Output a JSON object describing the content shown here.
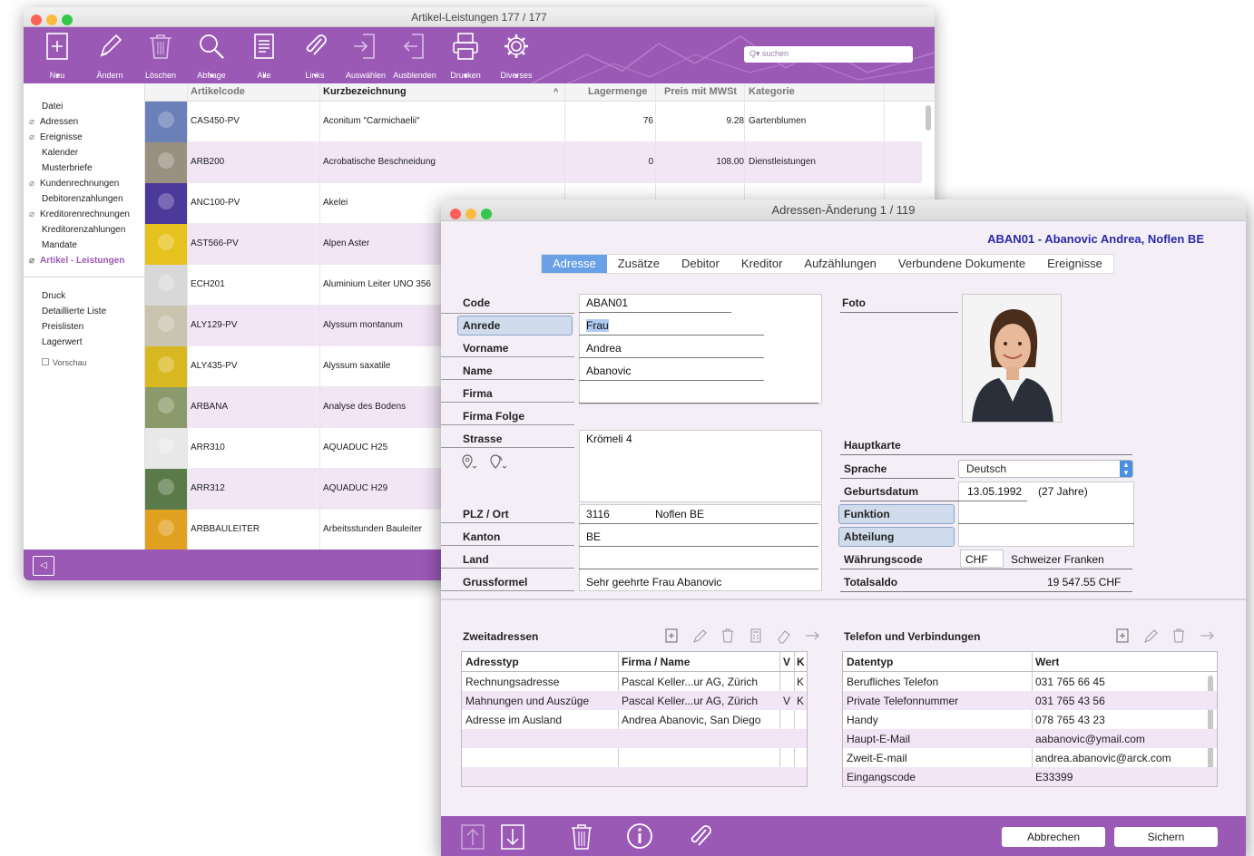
{
  "list_window": {
    "title": "Artikel-Leistungen  177 / 177",
    "toolbar": {
      "buttons": [
        {
          "label": "Neu",
          "icon": "new-document-icon",
          "dropdown": true
        },
        {
          "label": "Ändern",
          "icon": "pencil-icon",
          "dropdown": false
        },
        {
          "label": "Löschen",
          "icon": "trash-icon",
          "dropdown": false
        },
        {
          "label": "Abfrage",
          "icon": "magnifier-icon",
          "dropdown": true
        },
        {
          "label": "Alle",
          "icon": "document-list-icon",
          "dropdown": true
        },
        {
          "label": "Links",
          "icon": "paperclip-icon",
          "dropdown": true
        },
        {
          "label": "Auswählen",
          "icon": "select-arrow-icon",
          "dropdown": false
        },
        {
          "label": "Ausblenden",
          "icon": "hide-arrow-icon",
          "dropdown": false
        },
        {
          "label": "Drucken",
          "icon": "printer-icon",
          "dropdown": true
        },
        {
          "label": "Diverses",
          "icon": "gear-icon",
          "dropdown": true
        }
      ],
      "search_placeholder": "suchen"
    },
    "sidebar": {
      "items": [
        {
          "label": "Datei",
          "clip": false,
          "active": false
        },
        {
          "label": "Adressen",
          "clip": true,
          "active": false
        },
        {
          "label": "Ereignisse",
          "clip": true,
          "active": false
        },
        {
          "label": "Kalender",
          "clip": false,
          "active": false
        },
        {
          "label": "Musterbriefe",
          "clip": false,
          "active": false
        },
        {
          "label": "Kundenrechnungen",
          "clip": true,
          "active": false
        },
        {
          "label": "Debitorenzahlungen",
          "clip": false,
          "active": false
        },
        {
          "label": "Kreditorenrechnungen",
          "clip": true,
          "active": false
        },
        {
          "label": "Kreditorenzahlungen",
          "clip": false,
          "active": false
        },
        {
          "label": "Mandate",
          "clip": false,
          "active": false
        },
        {
          "label": "Artikel - Leistungen",
          "clip": true,
          "active": true
        }
      ],
      "reports": [
        "Druck",
        "Detaillierte Liste",
        "Preislisten",
        "Lagerwert"
      ],
      "preview_label": "Vorschau"
    },
    "columns": [
      "Artikelcode",
      "Kurzbezeichnung",
      "Lagermenge",
      "Preis mit MWSt",
      "Kategorie"
    ],
    "sort_indicator": "^",
    "rows": [
      {
        "code": "CAS450-PV",
        "name": "Aconitum \"Carmichaelii\"",
        "qty": "76",
        "price": "9.28",
        "cat": "Gartenblumen",
        "thumb": "#6b7fb8"
      },
      {
        "code": "ARB200",
        "name": "Acrobatische Beschneidung",
        "qty": "0",
        "price": "108.00",
        "cat": "Dienstleistungen",
        "thumb": "#9a9080"
      },
      {
        "code": "ANC100-PV",
        "name": "Akelei",
        "qty": "",
        "price": "",
        "cat": "",
        "thumb": "#4b3a9a"
      },
      {
        "code": "AST566-PV",
        "name": "Alpen Aster",
        "qty": "",
        "price": "",
        "cat": "",
        "thumb": "#e6c21e"
      },
      {
        "code": "ECH201",
        "name": "Aluminium Leiter UNO 356",
        "qty": "",
        "price": "",
        "cat": "",
        "thumb": "#d8d8d8"
      },
      {
        "code": "ALY129-PV",
        "name": "Alyssum montanum",
        "qty": "",
        "price": "",
        "cat": "",
        "thumb": "#c8c4b0"
      },
      {
        "code": "ALY435-PV",
        "name": "Alyssum saxatile",
        "qty": "",
        "price": "",
        "cat": "",
        "thumb": "#d8b820"
      },
      {
        "code": "ARBANA",
        "name": "Analyse des Bodens",
        "qty": "",
        "price": "",
        "cat": "",
        "thumb": "#8a9a6a"
      },
      {
        "code": "ARR310",
        "name": "AQUADUC H25",
        "qty": "",
        "price": "",
        "cat": "",
        "thumb": "#e8e8e8"
      },
      {
        "code": "ARR312",
        "name": "AQUADUC H29",
        "qty": "",
        "price": "",
        "cat": "",
        "thumb": "#5a7a4a"
      },
      {
        "code": "ARBBAULEITER",
        "name": "Arbeitsstunden Bauleiter",
        "qty": "",
        "price": "",
        "cat": "",
        "thumb": "#e0a020"
      }
    ]
  },
  "address_window": {
    "title": "Adressen-Änderung   1 / 119",
    "header": "ABAN01 - Abanovic Andrea, Noflen BE",
    "tabs": [
      "Adresse",
      "Zusätze",
      "Debitor",
      "Kreditor",
      "Aufzählungen",
      "Verbundene Dokumente",
      "Ereignisse"
    ],
    "fields": {
      "code_label": "Code",
      "code": "ABAN01",
      "anrede_label": "Anrede",
      "anrede": "Frau",
      "vorname_label": "Vorname",
      "vorname": "Andrea",
      "name_label": "Name",
      "name": "Abanovic",
      "firma_label": "Firma",
      "firma": "",
      "firma_folge_label": "Firma Folge",
      "firma_folge": "",
      "strasse_label": "Strasse",
      "strasse": "Krömeli 4",
      "plz_ort_label": "PLZ / Ort",
      "plz": "3116",
      "ort": "Noflen BE",
      "kanton_label": "Kanton",
      "kanton": "BE",
      "land_label": "Land",
      "land": "",
      "grussformel_label": "Grussformel",
      "grussformel": "Sehr geehrte Frau Abanovic"
    },
    "right": {
      "foto_label": "Foto",
      "hauptkarte_label": "Hauptkarte",
      "sprache_label": "Sprache",
      "sprache": "Deutsch",
      "geburtsdatum_label": "Geburtsdatum",
      "geburtsdatum": "13.05.1992",
      "alter": "(27 Jahre)",
      "funktion_label": "Funktion",
      "funktion": "",
      "abteilung_label": "Abteilung",
      "abteilung": "",
      "waehrung_label": "Währungscode",
      "waehrung_code": "CHF",
      "waehrung_name": "Schweizer Franken",
      "totalsaldo_label": "Totalsaldo",
      "totalsaldo": "19 547.55  CHF"
    },
    "zweitadressen": {
      "title": "Zweitadressen",
      "columns": [
        "Adresstyp",
        "Firma / Name",
        "V",
        "K"
      ],
      "rows": [
        {
          "typ": "Rechnungsadresse",
          "firma": "Pascal Keller...ur AG, Zürich",
          "v": "",
          "k": "K"
        },
        {
          "typ": "Mahnungen und Auszüge",
          "firma": "Pascal Keller...ur AG, Zürich",
          "v": "V",
          "k": "K"
        },
        {
          "typ": "Adresse im Ausland",
          "firma": "Andrea Abanovic, San Diego",
          "v": "",
          "k": ""
        },
        {
          "typ": "",
          "firma": "",
          "v": "",
          "k": ""
        },
        {
          "typ": "",
          "firma": "",
          "v": "",
          "k": ""
        },
        {
          "typ": "",
          "firma": "",
          "v": "",
          "k": ""
        }
      ]
    },
    "telefon": {
      "title": "Telefon und Verbindungen",
      "columns": [
        "Datentyp",
        "Wert"
      ],
      "rows": [
        {
          "typ": "Berufliches Telefon",
          "wert": "031 765 66 45"
        },
        {
          "typ": "Private Telefonnummer",
          "wert": "031 765 43 56"
        },
        {
          "typ": "Handy",
          "wert": "078 765 43 23"
        },
        {
          "typ": "Haupt-E-Mail",
          "wert": "aabanovic@ymail.com"
        },
        {
          "typ": "Zweit-E-mail",
          "wert": "andrea.abanovic@arck.com"
        },
        {
          "typ": "Eingangscode",
          "wert": "E33399"
        }
      ]
    },
    "footer": {
      "cancel_label": "Abbrechen",
      "save_label": "Sichern"
    }
  }
}
